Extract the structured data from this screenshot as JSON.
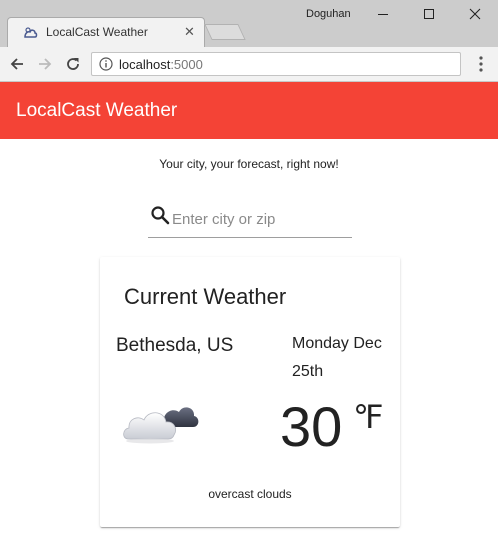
{
  "browser": {
    "tab_title": "LocalCast Weather",
    "tab_close": "✕",
    "user_name": "Doguhan",
    "url_host": "localhost",
    "url_port": ":5000"
  },
  "app": {
    "title": "LocalCast Weather",
    "tagline": "Your city, your forecast, right now!"
  },
  "search": {
    "placeholder": "Enter city or zip",
    "value": ""
  },
  "current_weather": {
    "heading": "Current Weather",
    "location": "Bethesda, US",
    "date": "Monday Dec 25th",
    "temperature": "30",
    "unit": "℉",
    "description": "overcast clouds",
    "icon": "overcast-clouds-icon"
  },
  "colors": {
    "accent": "#f44336",
    "chrome": "#cccccc",
    "tab": "#f2f2f2"
  }
}
